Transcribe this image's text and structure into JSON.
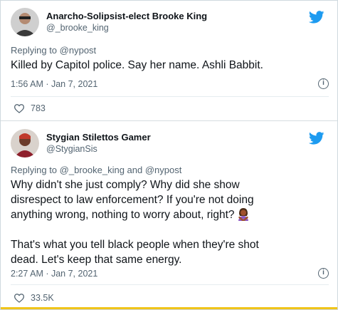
{
  "tweets": [
    {
      "name": "Anarcho-Solipsist-elect Brooke King",
      "handle": "@_brooke_king",
      "replying_label": "Replying to",
      "replying_to": "@nypost",
      "text": "Killed by Capitol police. Say her name. Ashli Babbit.",
      "timestamp": "1:56 AM · Jan 7, 2021",
      "likes": "783"
    },
    {
      "name": "Stygian Stilettos Gamer",
      "handle": "@StygianSis",
      "replying_label": "Replying to",
      "replying_to": "@_brooke_king and @nypost",
      "text_lines": [
        "Why didn't she just comply? Why did she show",
        "disrespect to law enforcement? If you're not doing",
        "anything wrong, nothing to worry about, right?"
      ],
      "text_lines2": [
        "That's what you tell black people when they're shot",
        "dead. Let's keep that same energy."
      ],
      "timestamp": "2:27 AM · Jan 7, 2021",
      "likes": "33.5K"
    }
  ],
  "icons": {
    "bird": "twitter-bird-icon",
    "info": "info-icon",
    "heart": "heart-icon",
    "emoji": "woman-gesturing-no-emoji"
  },
  "colors": {
    "twitter_blue": "#1d9bf0",
    "muted": "#536471",
    "text": "#0f1419"
  }
}
